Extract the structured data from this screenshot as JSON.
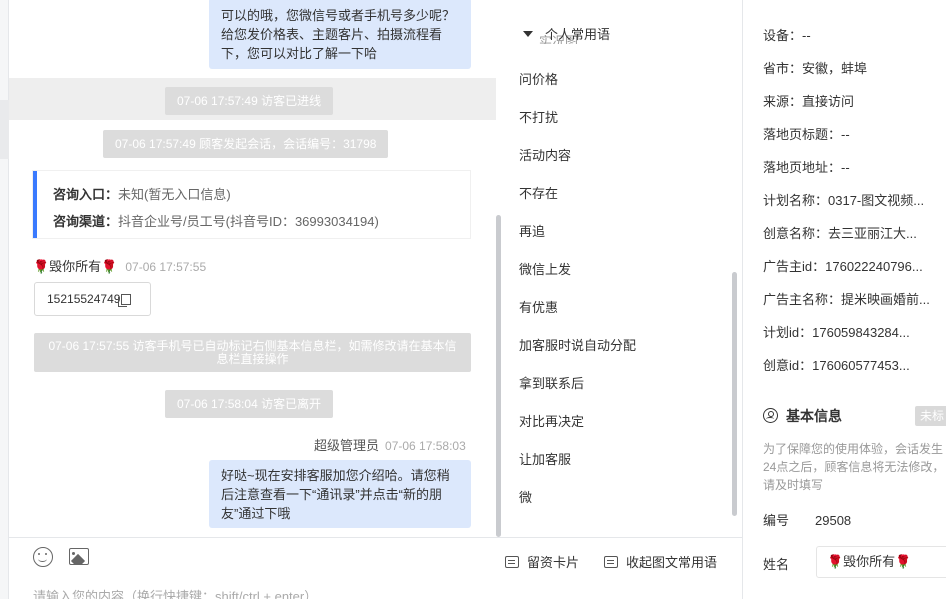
{
  "chat": {
    "msg_top": "可以的哦，您微信号或者手机号多少呢？给您发价格表、主题客片、拍摄流程看下，您可以对比了解一下哈",
    "sys_enter": "07-06 17:57:49 访客已进线",
    "sys_session": "07-06 17:57:49 顾客发起会话，会话编号：31798",
    "entry_label": "咨询入口：",
    "entry_value": "未知(暂无入口信息)",
    "channel_label": "咨询渠道：",
    "channel_value": "抖音企业号/员工号(抖音号ID：36993034194)",
    "visitor_name": "🌹毁你所有🌹",
    "visitor_time": "07-06 17:57:55",
    "visitor_phone": "15215524749",
    "sys_phone_marked": "07-06 17:57:55 访客手机号已自动标记右侧基本信息栏，如需修改请在基本信息栏直接操作",
    "sys_leave": "07-06 17:58:04 访客已离开",
    "agent_name": "超级管理员",
    "agent_time": "07-06 17:58:03",
    "msg_bottom": "好哒~现在安排客服加您介绍哈。请您稍后注意查看一下“通讯录”并点击“新的朋友”通过下哦"
  },
  "phrases": {
    "header": "个人常用语",
    "ghost": "实况图",
    "items": [
      "问价格",
      "不打扰",
      "活动内容",
      "不存在",
      "再追",
      "微信上发",
      "有优惠",
      "加客服时说自动分配",
      "拿到联系后",
      "对比再决定",
      "让加客服",
      "微"
    ]
  },
  "right": {
    "fields": [
      {
        "label": "设备：",
        "value": "--"
      },
      {
        "label": "省市：",
        "value": "安徽，蚌埠"
      },
      {
        "label": "来源：",
        "value": "直接访问"
      },
      {
        "label": "落地页标题：",
        "value": "--"
      },
      {
        "label": "落地页地址：",
        "value": "--"
      },
      {
        "label": "计划名称：",
        "value": "0317-图文视频..."
      },
      {
        "label": "创意名称：",
        "value": "去三亚丽江大..."
      },
      {
        "label": "广告主id：",
        "value": "176022240796..."
      },
      {
        "label": "广告主名称：",
        "value": "提米映画婚前..."
      },
      {
        "label": "计划id：",
        "value": "176059843284..."
      },
      {
        "label": "创意id：",
        "value": "176060577453..."
      }
    ],
    "basic_title": "基本信息",
    "basic_tag": "未标",
    "notice": "为了保障您的使用体验，会话发生24点之后，顾客信息将无法修改，请及时填写",
    "id_label": "编号",
    "id_value": "29508",
    "name_label": "姓名",
    "name_value": "🌹毁你所有🌹"
  },
  "editor": {
    "card_btn": "留资卡片",
    "collapse_btn": "收起图文常用语",
    "placeholder": "请输入您的内容（换行快捷键：shift/ctrl + enter）"
  }
}
